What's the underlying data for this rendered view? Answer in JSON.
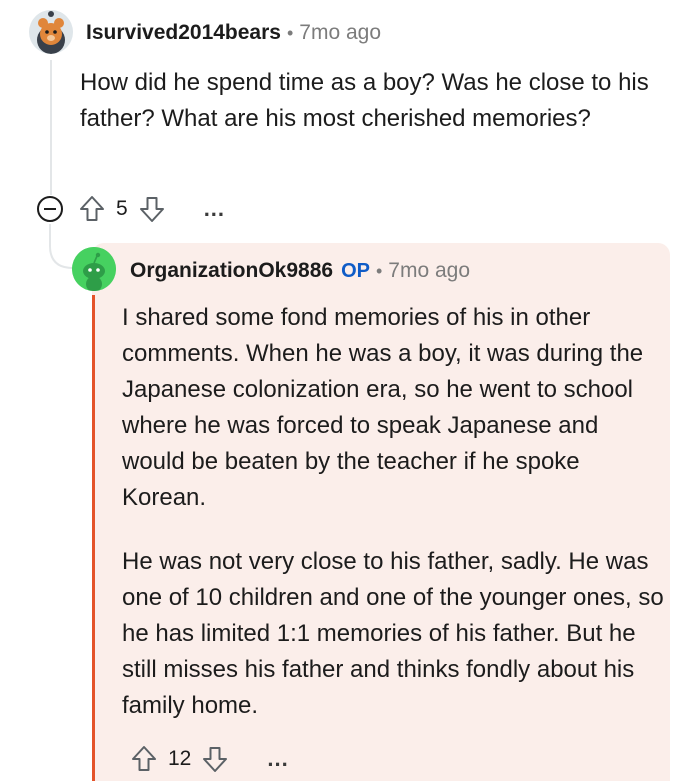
{
  "parent_comment": {
    "username": "Isurvived2014bears",
    "separator": "•",
    "timestamp": "7mo ago",
    "body": "How did he spend time as a boy? Was he close to his father? What are his most cherished memories?",
    "score": "5",
    "more_label": "..."
  },
  "reply_comment": {
    "username": "OrganizationOk9886",
    "op_badge": "OP",
    "separator": "•",
    "timestamp": "7mo ago",
    "paragraph_1": "I shared some fond memories of his in other comments. When he was a boy, it was during the Japanese colonization era, so he went to school where he was forced to speak Japanese and would be beaten by the teacher if he spoke Korean.",
    "paragraph_2": "He was not very close to his father, sadly. He was one of 10 children and one of the younger ones, so he has limited 1:1 memories of his father. But he still misses his father and thinks fondly about his family home.",
    "score": "12",
    "more_label": "..."
  },
  "colors": {
    "op_accent": "#0f5cc7",
    "highlight_bar": "#e4532a",
    "highlight_bg": "#fbeeea"
  },
  "icons": [
    "avatar-bear",
    "collapse-icon",
    "upvote-icon",
    "downvote-icon",
    "avatar-snoo-green"
  ]
}
